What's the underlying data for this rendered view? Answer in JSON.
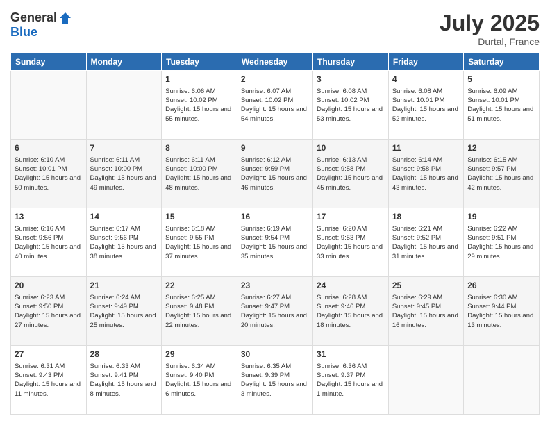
{
  "header": {
    "logo_general": "General",
    "logo_blue": "Blue",
    "month": "July 2025",
    "location": "Durtal, France"
  },
  "days_of_week": [
    "Sunday",
    "Monday",
    "Tuesday",
    "Wednesday",
    "Thursday",
    "Friday",
    "Saturday"
  ],
  "weeks": [
    [
      {
        "day": "",
        "empty": true
      },
      {
        "day": "",
        "empty": true
      },
      {
        "day": "1",
        "sunrise": "Sunrise: 6:06 AM",
        "sunset": "Sunset: 10:02 PM",
        "daylight": "Daylight: 15 hours and 55 minutes."
      },
      {
        "day": "2",
        "sunrise": "Sunrise: 6:07 AM",
        "sunset": "Sunset: 10:02 PM",
        "daylight": "Daylight: 15 hours and 54 minutes."
      },
      {
        "day": "3",
        "sunrise": "Sunrise: 6:08 AM",
        "sunset": "Sunset: 10:02 PM",
        "daylight": "Daylight: 15 hours and 53 minutes."
      },
      {
        "day": "4",
        "sunrise": "Sunrise: 6:08 AM",
        "sunset": "Sunset: 10:01 PM",
        "daylight": "Daylight: 15 hours and 52 minutes."
      },
      {
        "day": "5",
        "sunrise": "Sunrise: 6:09 AM",
        "sunset": "Sunset: 10:01 PM",
        "daylight": "Daylight: 15 hours and 51 minutes."
      }
    ],
    [
      {
        "day": "6",
        "sunrise": "Sunrise: 6:10 AM",
        "sunset": "Sunset: 10:01 PM",
        "daylight": "Daylight: 15 hours and 50 minutes."
      },
      {
        "day": "7",
        "sunrise": "Sunrise: 6:11 AM",
        "sunset": "Sunset: 10:00 PM",
        "daylight": "Daylight: 15 hours and 49 minutes."
      },
      {
        "day": "8",
        "sunrise": "Sunrise: 6:11 AM",
        "sunset": "Sunset: 10:00 PM",
        "daylight": "Daylight: 15 hours and 48 minutes."
      },
      {
        "day": "9",
        "sunrise": "Sunrise: 6:12 AM",
        "sunset": "Sunset: 9:59 PM",
        "daylight": "Daylight: 15 hours and 46 minutes."
      },
      {
        "day": "10",
        "sunrise": "Sunrise: 6:13 AM",
        "sunset": "Sunset: 9:58 PM",
        "daylight": "Daylight: 15 hours and 45 minutes."
      },
      {
        "day": "11",
        "sunrise": "Sunrise: 6:14 AM",
        "sunset": "Sunset: 9:58 PM",
        "daylight": "Daylight: 15 hours and 43 minutes."
      },
      {
        "day": "12",
        "sunrise": "Sunrise: 6:15 AM",
        "sunset": "Sunset: 9:57 PM",
        "daylight": "Daylight: 15 hours and 42 minutes."
      }
    ],
    [
      {
        "day": "13",
        "sunrise": "Sunrise: 6:16 AM",
        "sunset": "Sunset: 9:56 PM",
        "daylight": "Daylight: 15 hours and 40 minutes."
      },
      {
        "day": "14",
        "sunrise": "Sunrise: 6:17 AM",
        "sunset": "Sunset: 9:56 PM",
        "daylight": "Daylight: 15 hours and 38 minutes."
      },
      {
        "day": "15",
        "sunrise": "Sunrise: 6:18 AM",
        "sunset": "Sunset: 9:55 PM",
        "daylight": "Daylight: 15 hours and 37 minutes."
      },
      {
        "day": "16",
        "sunrise": "Sunrise: 6:19 AM",
        "sunset": "Sunset: 9:54 PM",
        "daylight": "Daylight: 15 hours and 35 minutes."
      },
      {
        "day": "17",
        "sunrise": "Sunrise: 6:20 AM",
        "sunset": "Sunset: 9:53 PM",
        "daylight": "Daylight: 15 hours and 33 minutes."
      },
      {
        "day": "18",
        "sunrise": "Sunrise: 6:21 AM",
        "sunset": "Sunset: 9:52 PM",
        "daylight": "Daylight: 15 hours and 31 minutes."
      },
      {
        "day": "19",
        "sunrise": "Sunrise: 6:22 AM",
        "sunset": "Sunset: 9:51 PM",
        "daylight": "Daylight: 15 hours and 29 minutes."
      }
    ],
    [
      {
        "day": "20",
        "sunrise": "Sunrise: 6:23 AM",
        "sunset": "Sunset: 9:50 PM",
        "daylight": "Daylight: 15 hours and 27 minutes."
      },
      {
        "day": "21",
        "sunrise": "Sunrise: 6:24 AM",
        "sunset": "Sunset: 9:49 PM",
        "daylight": "Daylight: 15 hours and 25 minutes."
      },
      {
        "day": "22",
        "sunrise": "Sunrise: 6:25 AM",
        "sunset": "Sunset: 9:48 PM",
        "daylight": "Daylight: 15 hours and 22 minutes."
      },
      {
        "day": "23",
        "sunrise": "Sunrise: 6:27 AM",
        "sunset": "Sunset: 9:47 PM",
        "daylight": "Daylight: 15 hours and 20 minutes."
      },
      {
        "day": "24",
        "sunrise": "Sunrise: 6:28 AM",
        "sunset": "Sunset: 9:46 PM",
        "daylight": "Daylight: 15 hours and 18 minutes."
      },
      {
        "day": "25",
        "sunrise": "Sunrise: 6:29 AM",
        "sunset": "Sunset: 9:45 PM",
        "daylight": "Daylight: 15 hours and 16 minutes."
      },
      {
        "day": "26",
        "sunrise": "Sunrise: 6:30 AM",
        "sunset": "Sunset: 9:44 PM",
        "daylight": "Daylight: 15 hours and 13 minutes."
      }
    ],
    [
      {
        "day": "27",
        "sunrise": "Sunrise: 6:31 AM",
        "sunset": "Sunset: 9:43 PM",
        "daylight": "Daylight: 15 hours and 11 minutes."
      },
      {
        "day": "28",
        "sunrise": "Sunrise: 6:33 AM",
        "sunset": "Sunset: 9:41 PM",
        "daylight": "Daylight: 15 hours and 8 minutes."
      },
      {
        "day": "29",
        "sunrise": "Sunrise: 6:34 AM",
        "sunset": "Sunset: 9:40 PM",
        "daylight": "Daylight: 15 hours and 6 minutes."
      },
      {
        "day": "30",
        "sunrise": "Sunrise: 6:35 AM",
        "sunset": "Sunset: 9:39 PM",
        "daylight": "Daylight: 15 hours and 3 minutes."
      },
      {
        "day": "31",
        "sunrise": "Sunrise: 6:36 AM",
        "sunset": "Sunset: 9:37 PM",
        "daylight": "Daylight: 15 hours and 1 minute."
      },
      {
        "day": "",
        "empty": true
      },
      {
        "day": "",
        "empty": true
      }
    ]
  ]
}
